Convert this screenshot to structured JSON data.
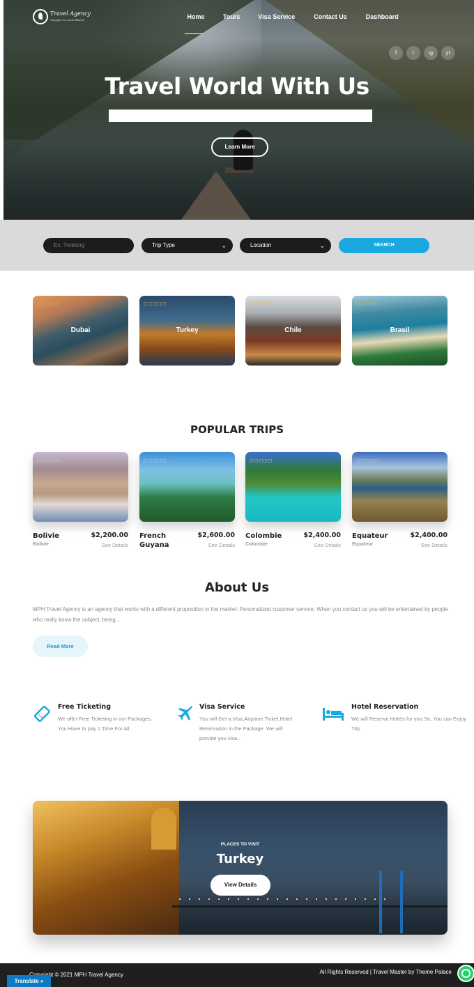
{
  "brand": {
    "name": "Travel Agency",
    "tagline": "Voyages en toute liberté"
  },
  "nav": {
    "home": "Home",
    "tours": "Tours",
    "visa": "Visa Service",
    "contact": "Contact Us",
    "dashboard": "Dashboard"
  },
  "social": {
    "facebook": "f",
    "twitter": "t",
    "instagram": "ig",
    "youtube": "yt"
  },
  "hero": {
    "title": "Travel World With Us",
    "button": "Learn More"
  },
  "search": {
    "keyword_placeholder": "Ex: Trekking",
    "trip_type": "Trip Type",
    "location": "Location",
    "button": "SEARCH",
    "chevron": "⌄"
  },
  "destinations": [
    {
      "name": "Dubai",
      "stars": "□□□□□"
    },
    {
      "name": "Turkey",
      "stars": "□□□□□"
    },
    {
      "name": "Chile",
      "stars": "□□□□□"
    },
    {
      "name": "Brasil",
      "stars": "□□□□□"
    }
  ],
  "popular": {
    "title": "POPULAR TRIPS",
    "see_details": "See Details",
    "trips": [
      {
        "name": "Bolivie",
        "sub": "Bolivie",
        "price": "$2,200.00",
        "stars": "□□□□□"
      },
      {
        "name": "French Guyana",
        "sub": "",
        "price": "$2,600.00",
        "stars": "□□□□□"
      },
      {
        "name": "Colombie",
        "sub": "Colombie",
        "price": "$2,400.00",
        "stars": "□□□□□"
      },
      {
        "name": "Equateur",
        "sub": "Equateur",
        "price": "$2,400.00",
        "stars": "□□□□□"
      }
    ]
  },
  "about": {
    "title": "About Us",
    "text": "MPH Travel Agency is an agency that works with a different proposition in the market: Personalized customer service. When you contact us you will be entertained by people who really know the subject, being...",
    "button": "Read More"
  },
  "features": [
    {
      "title": "Free Ticketing",
      "text": "We offer Free Ticketing in our Packages. You Have to pay 1 Time For All",
      "icon": "ticket-icon"
    },
    {
      "title": "Visa Service",
      "text": "You will Get a Visa,Airplane Ticket,Hotel Reservation  in the Package. We will provide you visa...",
      "icon": "airplane-icon"
    },
    {
      "title": "Hotel Reservation",
      "text": "We will Reserve Hotels for you.So, You can Enjoy Trip",
      "icon": "bed-icon"
    }
  ],
  "banner": {
    "subtitle": "PLACES TO VISIT",
    "title": "Turkey",
    "button": "View Details"
  },
  "footer": {
    "copyright": "Copyright © 2021 MPH Travel Agency",
    "rights": "All Rights Reserved | Travel Master by Theme Palace",
    "translate": "Translate »"
  },
  "colors": {
    "accent": "#19a8e0",
    "dark": "#1c1c1c",
    "footer": "#1f1f1f",
    "search_bg": "#dadada",
    "whatsapp": "#25d366"
  }
}
